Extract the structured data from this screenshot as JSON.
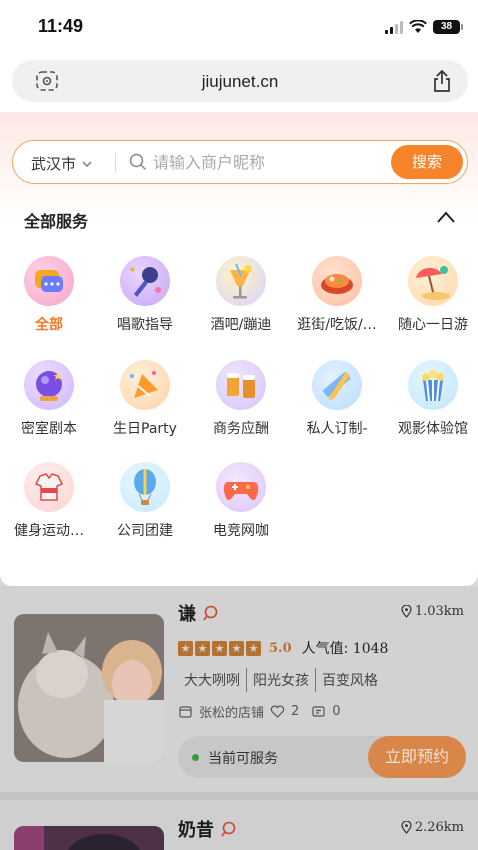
{
  "status_bar": {
    "time": "11:49",
    "battery": "38"
  },
  "browser": {
    "url": "jiujunet.cn"
  },
  "search": {
    "city": "武汉市",
    "placeholder": "请输入商户昵称",
    "button": "搜索"
  },
  "services": {
    "title": "全部服务",
    "items": [
      {
        "label": "全部",
        "icon": "all-chat-icon"
      },
      {
        "label": "唱歌指导",
        "icon": "microphone-icon"
      },
      {
        "label": "酒吧/蹦迪",
        "icon": "cocktail-icon"
      },
      {
        "label": "逛街/吃饭/…",
        "icon": "food-plate-icon"
      },
      {
        "label": "随心一日游",
        "icon": "beach-umbrella-icon"
      },
      {
        "label": "密室剧本",
        "icon": "crystal-ball-icon"
      },
      {
        "label": "生日Party",
        "icon": "party-horn-icon"
      },
      {
        "label": "商务应酬",
        "icon": "beer-toast-icon"
      },
      {
        "label": "私人订制-",
        "icon": "pencil-ruler-icon"
      },
      {
        "label": "观影体验馆",
        "icon": "popcorn-icon"
      },
      {
        "label": "健身运动…",
        "icon": "sport-shirt-icon"
      },
      {
        "label": "公司团建",
        "icon": "hot-air-balloon-icon"
      },
      {
        "label": "电竞网咖",
        "icon": "gamepad-icon"
      }
    ]
  },
  "listings": [
    {
      "name": "谦",
      "distance": "1.03km",
      "rating": "5.0",
      "popularity_label": "人气值:",
      "popularity": "1048",
      "tags": [
        "大大咧咧",
        "阳光女孩",
        "百变风格"
      ],
      "shop": "张松的店铺",
      "likes": "2",
      "comments": "0",
      "status": "当前可服务",
      "book_label": "立即预约"
    },
    {
      "name": "奶昔",
      "distance": "2.26km"
    }
  ],
  "colors": {
    "accent": "#f7842b",
    "active_label": "#f07a28",
    "star": "#b5722f"
  }
}
